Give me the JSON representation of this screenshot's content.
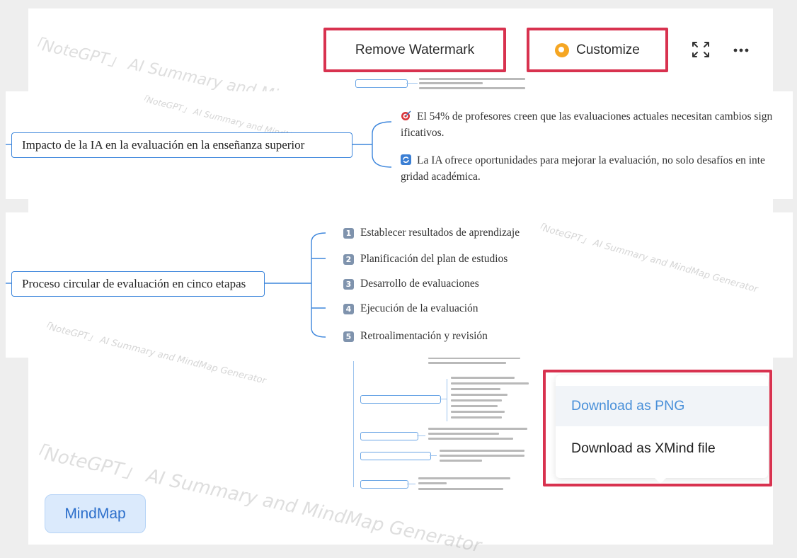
{
  "toolbar": {
    "remove_watermark_label": "Remove Watermark",
    "customize_label": "Customize",
    "expand_icon": "expand-arrows-icon",
    "more_icon": "more-horizontal-icon"
  },
  "watermark": {
    "text": "「NoteGPT」 AI Summary and MindMap Generator"
  },
  "mindmap": {
    "node_impact": {
      "label": "Impacto de la IA en la evaluación en la enseñanza superior",
      "children": [
        "El 54% de profesores creen que las evaluaciones actuales necesitan cambios sign ificativos.",
        "La IA ofrece oportunidades para mejorar la evaluación, no solo desafíos en inte gridad académica."
      ]
    },
    "node_process": {
      "label": "Proceso circular de evaluación en cinco etapas",
      "children": [
        {
          "num": "1",
          "text": "Establecer resultados de aprendizaje"
        },
        {
          "num": "2",
          "text": "Planificación del plan de estudios"
        },
        {
          "num": "3",
          "text": "Desarrollo de evaluaciones"
        },
        {
          "num": "4",
          "text": "Ejecución de la evaluación"
        },
        {
          "num": "5",
          "text": "Retroalimentación y revisión"
        }
      ]
    }
  },
  "download_menu": {
    "png_label": "Download as PNG",
    "xmind_label": "Download as XMind file"
  },
  "tabs": {
    "mindmap_label": "MindMap"
  },
  "colors": {
    "highlight": "#d8324f",
    "accent_blue": "#3d86dc",
    "menu_active_text": "#4a90d9",
    "customize_badge": "#f5a623"
  }
}
